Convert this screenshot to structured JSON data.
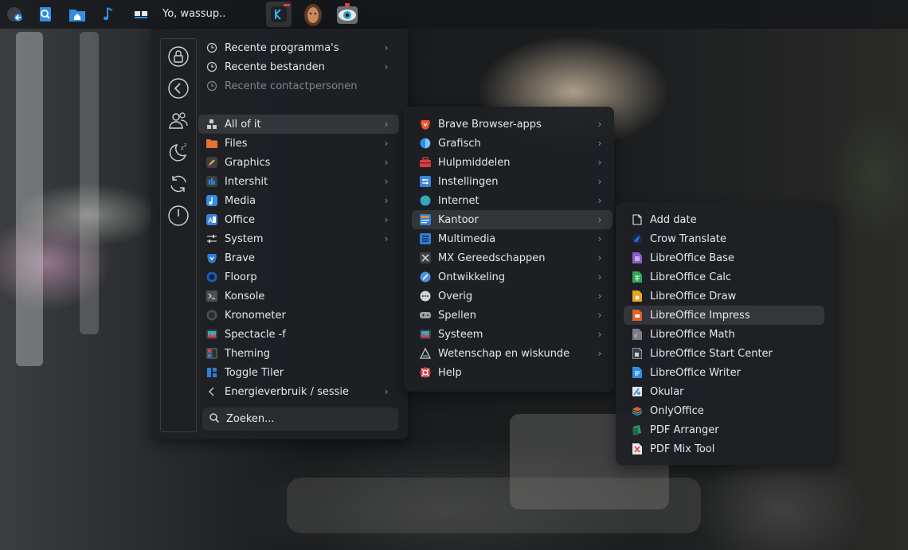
{
  "panel": {
    "greeting": "Yo, wassup..",
    "launchers": [
      {
        "icon": "kde-menu-icon"
      },
      {
        "icon": "file-search-icon"
      },
      {
        "icon": "home-folder-icon"
      },
      {
        "icon": "music-note-icon"
      },
      {
        "icon": "window-tiles-icon"
      }
    ],
    "tasks": [
      {
        "icon": "kde-app-icon"
      },
      {
        "icon": "avatar-face-icon"
      },
      {
        "icon": "eye-icon"
      }
    ]
  },
  "sidebar": {
    "buttons": [
      {
        "icon": "lock-icon"
      },
      {
        "icon": "back-arrow-icon"
      },
      {
        "icon": "switch-user-icon"
      },
      {
        "icon": "sleep-icon"
      },
      {
        "icon": "restart-icon"
      },
      {
        "icon": "power-icon"
      }
    ]
  },
  "main_menu": {
    "recent": [
      {
        "label": "Recente programma's",
        "icon": "clock-icon",
        "disabled": false
      },
      {
        "label": "Recente bestanden",
        "icon": "clock-icon",
        "disabled": false
      },
      {
        "label": "Recente contactpersonen",
        "icon": "clock-icon",
        "disabled": true
      }
    ],
    "categories": [
      {
        "label": "All of it",
        "icon": "grid-icon",
        "submenu": true,
        "color": "#c8ccd0"
      },
      {
        "label": "Files",
        "icon": "folder-icon",
        "submenu": true,
        "color": "#e6722e"
      },
      {
        "label": "Graphics",
        "icon": "graphics-icon",
        "submenu": true,
        "color": "#3a3f46"
      },
      {
        "label": "Intershit",
        "icon": "internet-icon",
        "submenu": true,
        "color": "#3a3f46"
      },
      {
        "label": "Media",
        "icon": "media-icon",
        "submenu": true,
        "color": "#2f8fd6"
      },
      {
        "label": "Office",
        "icon": "office-icon",
        "submenu": true,
        "color": "#3b82e0"
      },
      {
        "label": "System",
        "icon": "sliders-icon",
        "submenu": true,
        "color": "#c8ccd0"
      },
      {
        "label": "Brave",
        "icon": "brave-icon",
        "submenu": false,
        "color": "#2f7fd8"
      },
      {
        "label": "Floorp",
        "icon": "floorp-icon",
        "submenu": false,
        "color": "#1c5fb3"
      },
      {
        "label": "Konsole",
        "icon": "terminal-icon",
        "submenu": false,
        "color": "#4a4f56"
      },
      {
        "label": "Kronometer",
        "icon": "stopwatch-icon",
        "submenu": false,
        "color": "#4a4f56"
      },
      {
        "label": "Spectacle -f",
        "icon": "screenshot-icon",
        "submenu": false,
        "color": "#3fa7b7"
      },
      {
        "label": "Theming",
        "icon": "theming-icon",
        "submenu": false,
        "color": "#4a4f56"
      },
      {
        "label": "Toggle Tiler",
        "icon": "tiler-icon",
        "submenu": false,
        "color": "#2f7fd8"
      },
      {
        "label": "Energieverbruik / sessie",
        "icon": "chevron-left-icon",
        "submenu": true,
        "color": "#c8ccd0"
      }
    ],
    "search_label": "Zoeken..."
  },
  "submenu_all": {
    "items": [
      {
        "label": "Brave Browser-apps",
        "icon": "brave-icon",
        "submenu": true,
        "color": "#f0542c"
      },
      {
        "label": "Grafisch",
        "icon": "graphics-icon",
        "submenu": true,
        "color": "#2f8fe6"
      },
      {
        "label": "Hulpmiddelen",
        "icon": "toolbox-icon",
        "submenu": true,
        "color": "#d84040"
      },
      {
        "label": "Instellingen",
        "icon": "settings-icon",
        "submenu": true,
        "color": "#3b82e0"
      },
      {
        "label": "Internet",
        "icon": "globe-icon",
        "submenu": true,
        "color": "#2f9fe0"
      },
      {
        "label": "Kantoor",
        "icon": "office-icon",
        "submenu": true,
        "color": "#f08a24"
      },
      {
        "label": "Multimedia",
        "icon": "multimedia-icon",
        "submenu": true,
        "color": "#2f7fd8"
      },
      {
        "label": "MX Gereedschappen",
        "icon": "mx-tools-icon",
        "submenu": true,
        "color": "#c8ccd0"
      },
      {
        "label": "Ontwikkeling",
        "icon": "development-icon",
        "submenu": true,
        "color": "#4a90e2"
      },
      {
        "label": "Overig",
        "icon": "more-icon",
        "submenu": true,
        "color": "#d0d3d6"
      },
      {
        "label": "Spellen",
        "icon": "gamepad-icon",
        "submenu": true,
        "color": "#9aa0a6"
      },
      {
        "label": "Systeem",
        "icon": "system-icon",
        "submenu": true,
        "color": "#3fa7b7"
      },
      {
        "label": "Wetenschap en wiskunde",
        "icon": "science-icon",
        "submenu": true,
        "color": "#c8ccd0"
      },
      {
        "label": "Help",
        "icon": "help-icon",
        "submenu": false,
        "color": "#e04040"
      }
    ]
  },
  "submenu_office": {
    "items": [
      {
        "label": "Add date",
        "icon": "document-icon",
        "color": "#e6e8ea"
      },
      {
        "label": "Crow Translate",
        "icon": "crow-translate-icon",
        "color": "#2f6fd0"
      },
      {
        "label": "LibreOffice Base",
        "icon": "libreoffice-base-icon",
        "color": "#8e5bc8"
      },
      {
        "label": "LibreOffice Calc",
        "icon": "libreoffice-calc-icon",
        "color": "#2faa52"
      },
      {
        "label": "LibreOffice Draw",
        "icon": "libreoffice-draw-icon",
        "color": "#f0a21e"
      },
      {
        "label": "LibreOffice Impress",
        "icon": "libreoffice-impress-icon",
        "color": "#e8602c"
      },
      {
        "label": "LibreOffice Math",
        "icon": "libreoffice-math-icon",
        "color": "#7a7f86"
      },
      {
        "label": "LibreOffice Start Center",
        "icon": "libreoffice-start-icon",
        "color": "#d0d3d6"
      },
      {
        "label": "LibreOffice Writer",
        "icon": "libreoffice-writer-icon",
        "color": "#2f8fe6"
      },
      {
        "label": "Okular",
        "icon": "okular-icon",
        "color": "#5a8fd8"
      },
      {
        "label": "OnlyOffice",
        "icon": "onlyoffice-icon",
        "color": "#e65a3a"
      },
      {
        "label": "PDF Arranger",
        "icon": "pdf-arranger-icon",
        "color": "#2f9a6a"
      },
      {
        "label": "PDF Mix Tool",
        "icon": "pdf-mix-icon",
        "color": "#d84040"
      }
    ]
  }
}
